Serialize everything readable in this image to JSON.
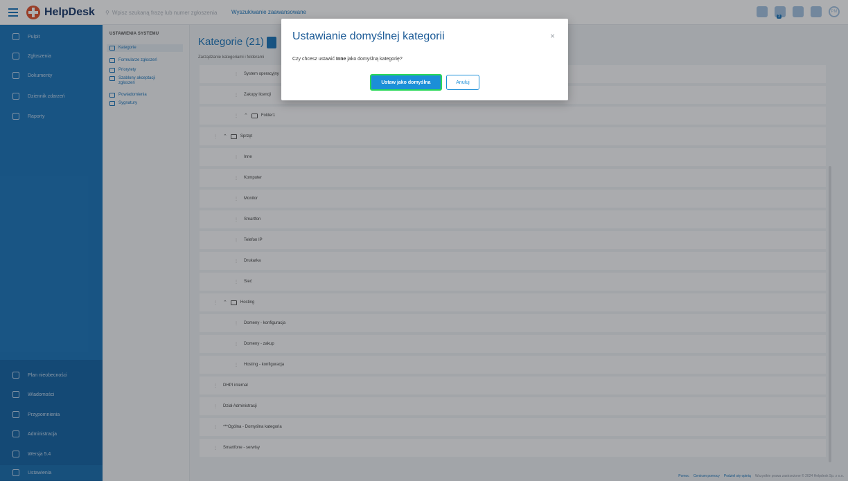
{
  "topbar": {
    "logo_text": "HelpDesk",
    "search_placeholder": "Wpisz szukaną frazę lub numer zgłoszenia",
    "advanced_link": "Wyszukiwanie zaawansowane",
    "icons": [
      "grid-icon",
      "notifications-icon",
      "chat-icon",
      "message-icon",
      "avatar"
    ],
    "notifications_badge": "3",
    "avatar_initials": "PM"
  },
  "sidebar": {
    "items": [
      {
        "label": "Pulpit",
        "icon": "dashboard-icon"
      },
      {
        "label": "Zgłoszenia",
        "icon": "tickets-icon"
      },
      {
        "label": "Dokumenty",
        "icon": "documents-icon"
      },
      {
        "label": "Dziennik zdarzeń",
        "icon": "log-icon"
      },
      {
        "label": "Raporty",
        "icon": "reports-icon"
      }
    ],
    "bottom_items": [
      {
        "label": "Plan nieobecności",
        "icon": "people-icon"
      },
      {
        "label": "Wiadomości",
        "icon": "mail-icon"
      },
      {
        "label": "Przypomnienia",
        "icon": "bell-icon"
      },
      {
        "label": "Administracja",
        "icon": "admin-icon"
      },
      {
        "label": "Wersja 5.4",
        "icon": "info-icon"
      },
      {
        "label": "Ustawienia",
        "icon": "gear-icon"
      }
    ]
  },
  "subnav": {
    "title": "USTAWIENIA SYSTEMU",
    "items": [
      {
        "label": "Kategorie"
      },
      {
        "label": "Formularze zgłoszeń"
      },
      {
        "label": "Priorytety"
      },
      {
        "label": "Szablony akceptacji zgłoszeń"
      },
      {
        "label": "Powiadomienia"
      },
      {
        "label": "Sygnatury"
      }
    ]
  },
  "main": {
    "title": "Kategorie (21)",
    "subtitle": "Zarządzanie kategoriami i folderami",
    "tree": [
      {
        "label": "System operacyjny",
        "level": 2,
        "folder": false
      },
      {
        "label": "Zakupy licencji",
        "level": 2,
        "folder": false
      },
      {
        "label": "Folder1",
        "level": 2,
        "folder": true
      },
      {
        "label": "Sprzęt",
        "level": 1,
        "folder": true
      },
      {
        "label": "Inne",
        "level": 2,
        "folder": false
      },
      {
        "label": "Komputer",
        "level": 2,
        "folder": false
      },
      {
        "label": "Monitor",
        "level": 2,
        "folder": false
      },
      {
        "label": "Smartfon",
        "level": 2,
        "folder": false
      },
      {
        "label": "Telefon IP",
        "level": 2,
        "folder": false
      },
      {
        "label": "Drukarka",
        "level": 2,
        "folder": false
      },
      {
        "label": "Sieć",
        "level": 2,
        "folder": false
      },
      {
        "label": "Hosting",
        "level": 1,
        "folder": true
      },
      {
        "label": "Domeny - konfiguracja",
        "level": 2,
        "folder": false
      },
      {
        "label": "Domeny - zakup",
        "level": 2,
        "folder": false
      },
      {
        "label": "Hosting - konfiguracja",
        "level": 2,
        "folder": false
      },
      {
        "label": "DHPI internal",
        "level": 1,
        "folder": false
      },
      {
        "label": "Dział Administracji",
        "level": 1,
        "folder": false
      },
      {
        "label": "***Ogólna - Domyślna kategoria",
        "level": 1,
        "folder": false
      },
      {
        "label": "Smartfone - serwisy",
        "level": 1,
        "folder": false
      }
    ]
  },
  "footer": {
    "links": [
      "Pomoc",
      "Centrum pomocy",
      "Podziel się opinią"
    ],
    "copyright": "Wszystkie prawa zastrzeżone © 2024 Helpdesk Sp. z o.o."
  },
  "modal": {
    "title": "Ustawianie domyślnej kategorii",
    "text_before": "Czy chcesz ustawić ",
    "text_bold": "Inne",
    "text_after": " jako domyślną kategorię?",
    "confirm_label": "Ustaw jako domyślna",
    "cancel_label": "Anuluj",
    "close_symbol": "×"
  }
}
